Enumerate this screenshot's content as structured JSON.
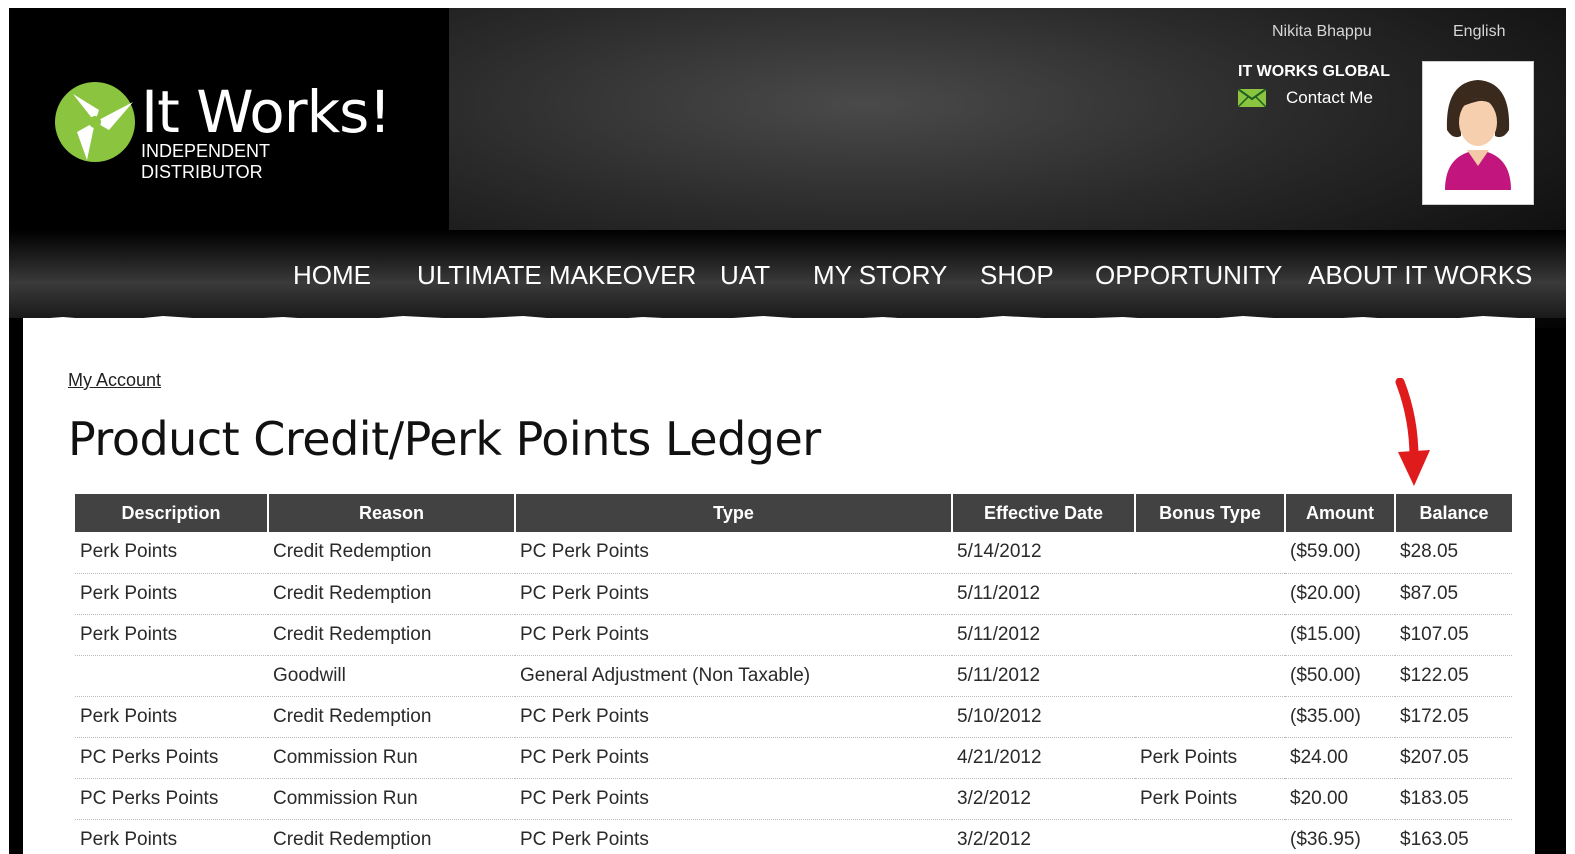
{
  "header": {
    "logo_word": "It Works!",
    "logo_subtitle": "INDEPENDENT DISTRIBUTOR",
    "user_name": "Nikita Bhappu",
    "language": "English",
    "brand": "IT WORKS GLOBAL",
    "contact_label": "Contact Me"
  },
  "nav": {
    "items": [
      {
        "label": "HOME"
      },
      {
        "label": "ULTIMATE MAKEOVER"
      },
      {
        "label": "UAT"
      },
      {
        "label": "MY STORY"
      },
      {
        "label": "SHOP"
      },
      {
        "label": "OPPORTUNITY"
      },
      {
        "label": "ABOUT IT WORKS"
      }
    ]
  },
  "breadcrumb": "My Account",
  "page_title": "Product Credit/Perk Points Ledger",
  "table": {
    "headers": [
      "Description",
      "Reason",
      "Type",
      "Effective Date",
      "Bonus Type",
      "Amount",
      "Balance"
    ],
    "rows": [
      [
        "Perk Points",
        "Credit Redemption",
        "PC Perk Points",
        "5/14/2012",
        "",
        "($59.00)",
        "$28.05"
      ],
      [
        "Perk Points",
        "Credit Redemption",
        "PC Perk Points",
        "5/11/2012",
        "",
        "($20.00)",
        "$87.05"
      ],
      [
        "Perk Points",
        "Credit Redemption",
        "PC Perk Points",
        "5/11/2012",
        "",
        "($15.00)",
        "$107.05"
      ],
      [
        "",
        "Goodwill",
        "General Adjustment (Non Taxable)",
        "5/11/2012",
        "",
        "($50.00)",
        "$122.05"
      ],
      [
        "Perk Points",
        "Credit Redemption",
        "PC Perk Points",
        "5/10/2012",
        "",
        "($35.00)",
        "$172.05"
      ],
      [
        "PC Perks Points",
        "Commission Run",
        "PC Perk Points",
        "4/21/2012",
        "Perk Points",
        "$24.00",
        "$207.05"
      ],
      [
        "PC Perks Points",
        "Commission Run",
        "PC Perk Points",
        "3/2/2012",
        "Perk Points",
        "$20.00",
        "$183.05"
      ],
      [
        "Perk Points",
        "Credit Redemption",
        "PC Perk Points",
        "3/2/2012",
        "",
        "($36.95)",
        "$163.05"
      ]
    ]
  },
  "colors": {
    "brand_green": "#8bc540",
    "header_bg": "#424242",
    "arrow_red": "#e01b1b"
  },
  "icons": {
    "logo": "it-works-logo-icon",
    "mail": "mail-icon",
    "avatar": "avatar-icon",
    "arrow": "red-arrow-annotation-icon"
  }
}
